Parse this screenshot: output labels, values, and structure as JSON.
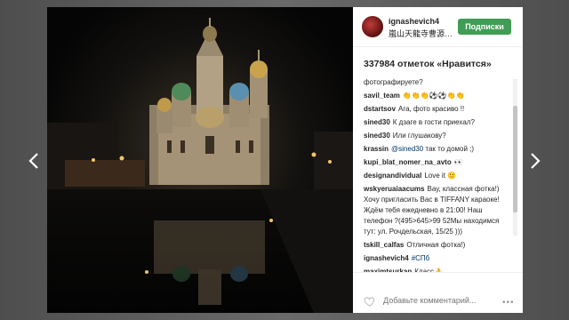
{
  "post": {
    "username": "ignashevich4",
    "location": "嵐山天龍寺曹源…",
    "follow_label": "Подписки",
    "likes_text": "337984 отметок «Нравится»",
    "comments": [
      {
        "user": "",
        "text": "фотографируете?"
      },
      {
        "user": "savil_team",
        "text": "👏👏👏⚽⚽👏👏"
      },
      {
        "user": "dstartsov",
        "text": "Ага, фото красиво !!"
      },
      {
        "user": "sined30",
        "text": "К дзаге в гости приехал?"
      },
      {
        "user": "sined30",
        "text": "Или глушакову?"
      },
      {
        "user": "krassin",
        "mention": "@sined30",
        "text": "так то домой ;)"
      },
      {
        "user": "kupi_blat_nomer_na_avto",
        "text": "👀"
      },
      {
        "user": "designandividual",
        "text": "Love it 🙂"
      },
      {
        "user": "wskyeruaiaacums",
        "text": "Вау, классная фотка!) Хочу пригласить Вас в TIFFANY караоке! Ждём тебя ежедневно в 21:00! Наш телефон ?(495>645>99 52Мы находимся тут: ул. Рочдельская, 15/25 )))"
      },
      {
        "user": "tskill_calfas",
        "text": "Отличная фотка!)"
      },
      {
        "user": "ignashevich4",
        "hashtag": "#СПб",
        "text": ""
      },
      {
        "user": "maximtsurkan",
        "text": "Класс👌"
      }
    ],
    "comment_placeholder": "Добавьте комментарий...",
    "more_label": "•••"
  },
  "icons": {
    "prev": "chevron-left-icon",
    "next": "chevron-right-icon",
    "like": "heart-icon",
    "options": "ellipsis-icon"
  },
  "colors": {
    "follow": "#3f9d55",
    "link": "#003569"
  }
}
